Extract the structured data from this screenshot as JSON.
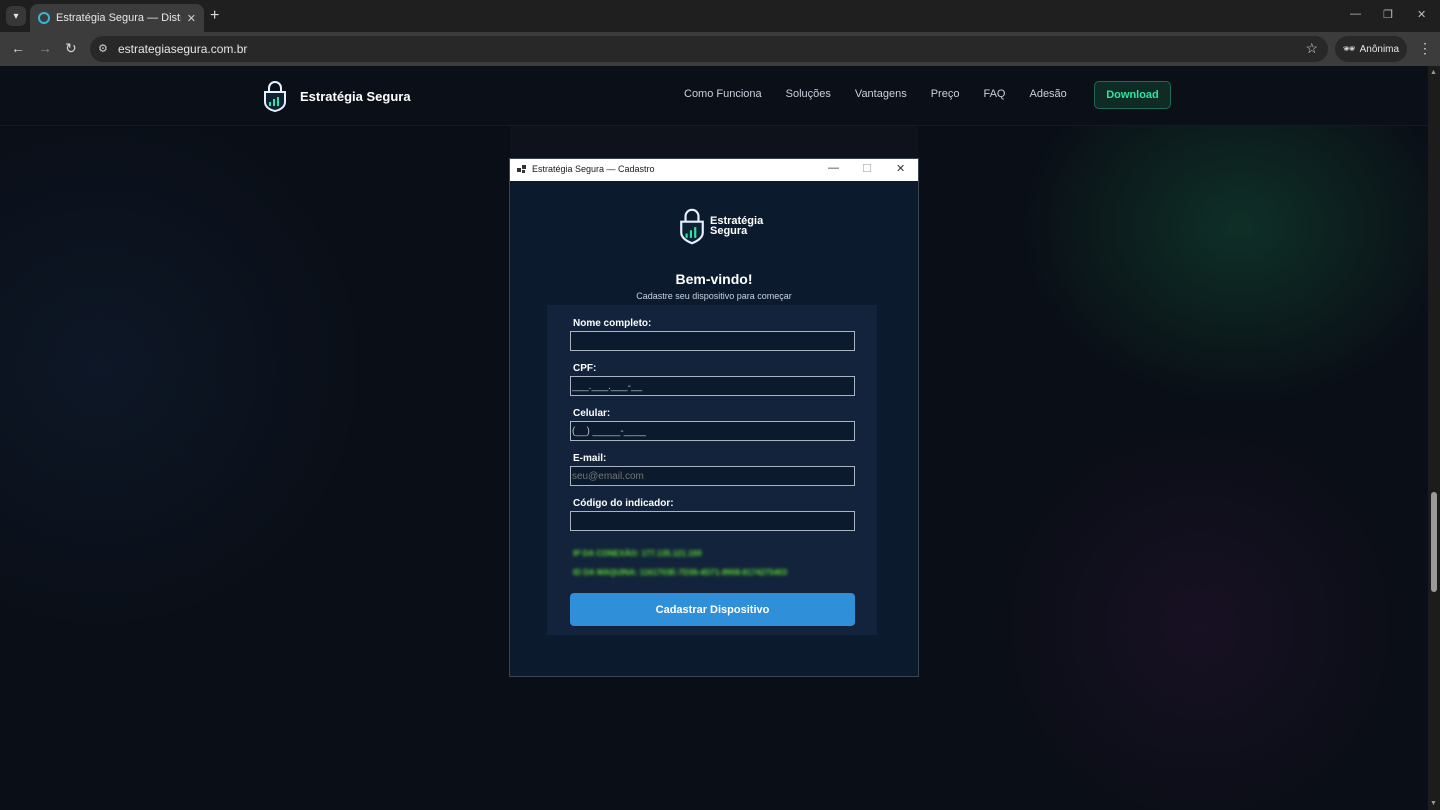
{
  "browser": {
    "tab_title": "Estratégia Segura — Distribuição",
    "url": "estrategiasegura.com.br",
    "incognito_label": "Anônima"
  },
  "site": {
    "brand_name": "Estratégia Segura",
    "nav": [
      "Como Funciona",
      "Soluções",
      "Vantagens",
      "Preço",
      "FAQ",
      "Adesão"
    ],
    "download_label": "Download",
    "accent_color": "#2fe3a0"
  },
  "dialog": {
    "title": "Estratégia Segura — Cadastro",
    "logo_line1": "Estratégia",
    "logo_line2": "Segura",
    "welcome": "Bem-vindo!",
    "subtitle": "Cadastre seu dispositivo para começar",
    "fields": [
      {
        "label": "Nome completo:",
        "value": "",
        "placeholder": ""
      },
      {
        "label": "CPF:",
        "value": "___.___.___-__",
        "placeholder": ""
      },
      {
        "label": "Celular:",
        "value": "(__) _____-____",
        "placeholder": ""
      },
      {
        "label": "E-mail:",
        "value": "",
        "placeholder": "seu@email.com"
      },
      {
        "label": "Código do indicador:",
        "value": "",
        "placeholder": ""
      }
    ],
    "ip_line": "IP DA CONEXÃO: 177.135.121.169",
    "machine_line": "ID DA MÁQUINA: 1161703E-7D36-4D71-8908-8174275403",
    "submit_label": "Cadastrar Dispositivo",
    "button_color": "#2f8fd8"
  }
}
